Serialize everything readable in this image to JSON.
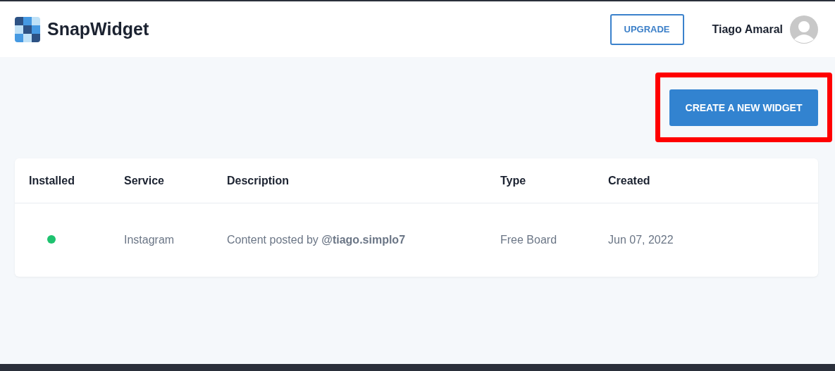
{
  "header": {
    "brand": "SnapWidget",
    "upgrade_button": "UPGRADE",
    "user_name": "Tiago Amaral"
  },
  "create_button": {
    "label": "CREATE A NEW WIDGET",
    "highlighted": true
  },
  "table": {
    "columns": [
      "Installed",
      "Service",
      "Description",
      "Type",
      "Created"
    ],
    "rows": [
      {
        "color": "#1ec26f",
        "service": "Instagram",
        "description": "Content posted by **@tiago.simplo7**",
        "type": "Free Board",
        "created": "Jun 07, 2022"
      }
    ]
  }
}
